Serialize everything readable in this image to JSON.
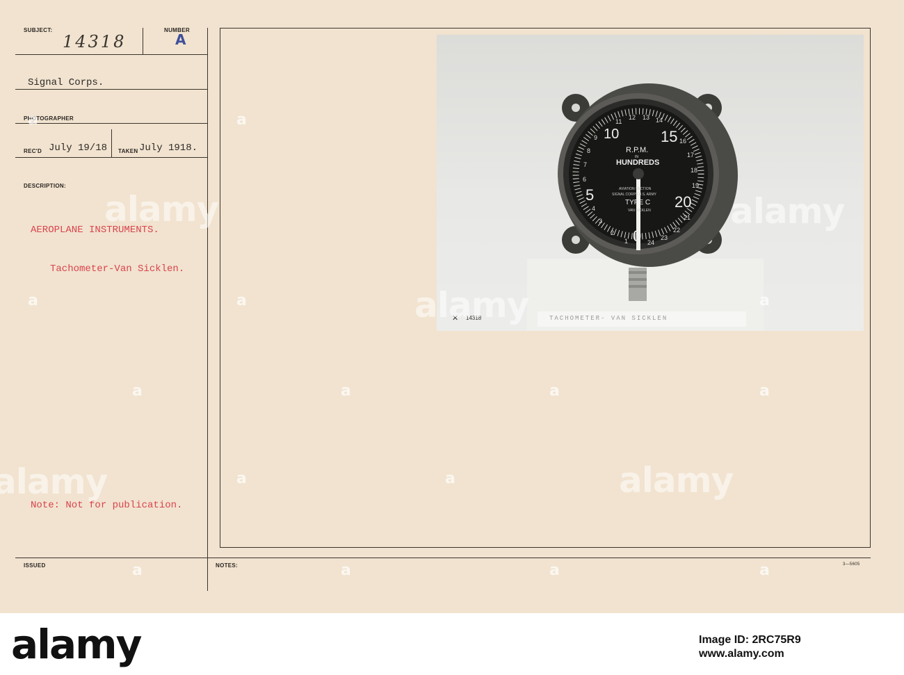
{
  "record": {
    "subject_label": "SUBJECT:",
    "subject_number": "14318",
    "number_label": "NUMBER",
    "number_value": "A",
    "organization": "Signal Corps.",
    "photographer_label": "PHOTOGRAPHER",
    "recd_label": "REC'D",
    "recd_date": "July 19/18",
    "taken_label": "TAKEN",
    "taken_date": "July 1918.",
    "description_label": "DESCRIPTION:",
    "description_title": "AEROPLANE INSTRUMENTS.",
    "description_item": "Tachometer-Van Sicklen.",
    "note": "Note: Not for publication.",
    "issued_label": "ISSUED",
    "notes_label": "NOTES:",
    "form_code": "3—5605"
  },
  "photo": {
    "negative_number": "14318",
    "caption_strip": "TACHOMETER- VAN SICKLEN",
    "dial": {
      "units_line1": "R.P.M.",
      "units_line2": "IN",
      "units_line3": "HUNDREDS",
      "maker_line1": "AVIATION SECTION",
      "maker_line2": "SIGNAL CORPS U.S. ARMY",
      "type_text": "TYPE C",
      "maker_line3": "VAN SICKLEN",
      "large_numbers": [
        "0",
        "5",
        "10",
        "15",
        "20"
      ],
      "small_numbers": [
        "1",
        "2",
        "3",
        "4",
        "6",
        "7",
        "8",
        "9",
        "11",
        "12",
        "13",
        "14",
        "16",
        "17",
        "18",
        "19",
        "21",
        "22",
        "23",
        "24"
      ]
    }
  },
  "watermark": {
    "brand": "alamy",
    "mark": "a"
  },
  "footer": {
    "brand": "alamy",
    "image_id": "Image ID: 2RC75R9",
    "url": "www.alamy.com"
  }
}
